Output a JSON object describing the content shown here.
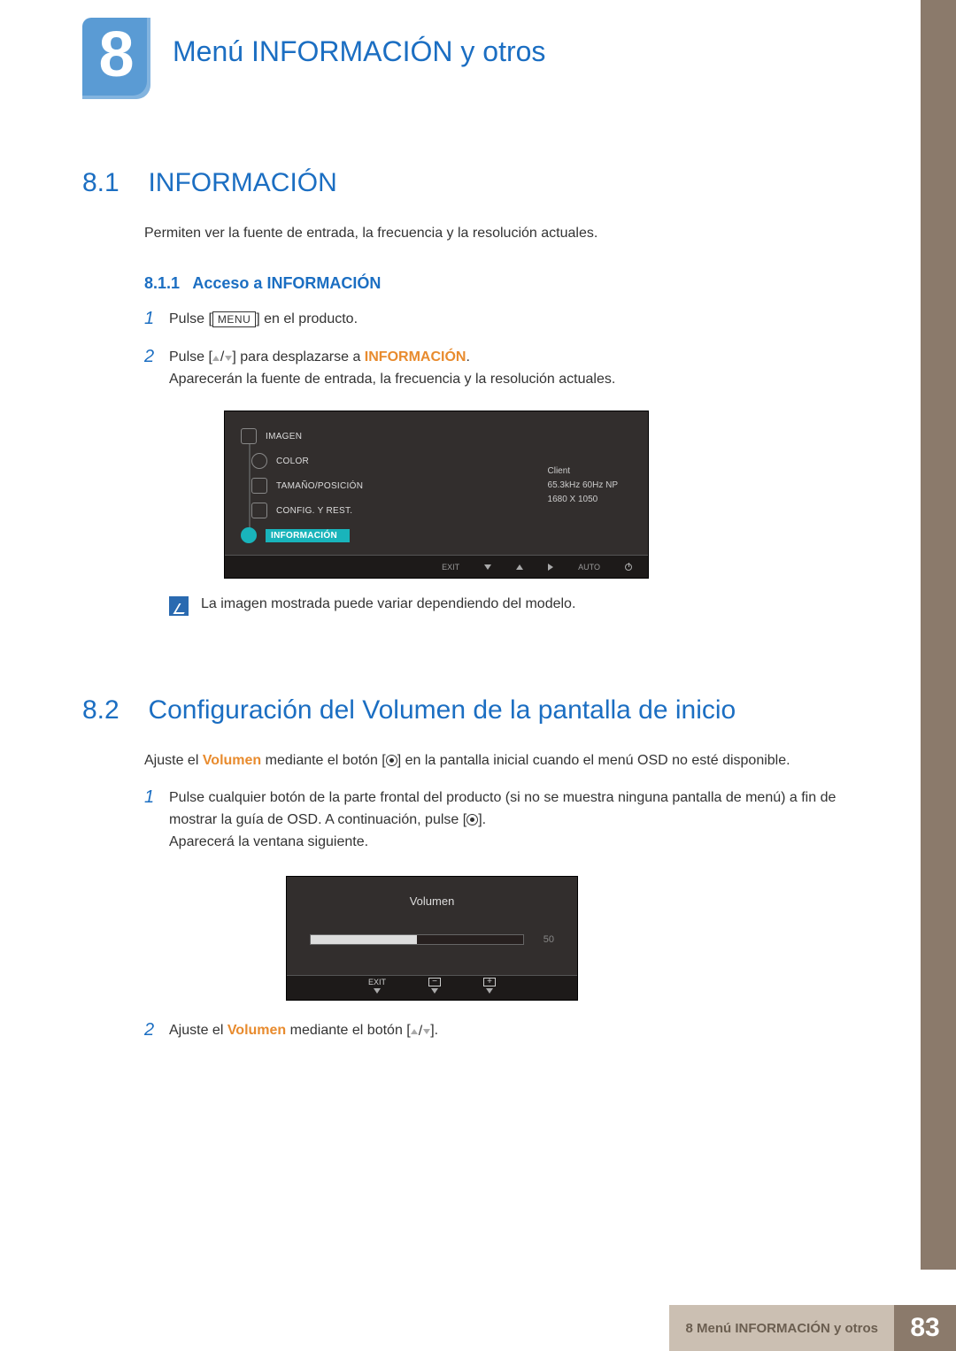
{
  "chapter": {
    "number": "8",
    "title": "Menú INFORMACIÓN y otros"
  },
  "section1": {
    "num": "8.1",
    "title": "INFORMACIÓN",
    "intro": "Permiten ver la fuente de entrada, la frecuencia y la resolución actuales.",
    "sub": {
      "num": "8.1.1",
      "title": "Acceso a INFORMACIÓN"
    },
    "steps": {
      "s1a": "Pulse [",
      "s1key": "MENU",
      "s1b": "] en el producto.",
      "s2a": "Pulse [",
      "s2b": "] para desplazarse a ",
      "s2orange": "INFORMACIÓN",
      "s2c": ".",
      "s2d": "Aparecerán la fuente de entrada, la frecuencia y la resolución actuales."
    },
    "osd": {
      "items": [
        "IMAGEN",
        "COLOR",
        "TAMAÑO/POSICIÓN",
        "CONFIG. Y REST.",
        "INFORMACIÓN"
      ],
      "info": {
        "l1": "Client",
        "l2": "65.3kHz 60Hz NP",
        "l3": "1680 X 1050"
      },
      "footer": {
        "exit": "EXIT",
        "auto": "AUTO"
      }
    },
    "note": "La imagen mostrada puede variar dependiendo del modelo."
  },
  "section2": {
    "num": "8.2",
    "title": "Configuración del Volumen de la pantalla de inicio",
    "intro_a": "Ajuste el ",
    "intro_orange": "Volumen",
    "intro_b": " mediante el botón [",
    "intro_c": "] en la pantalla inicial cuando el menú OSD no esté disponible.",
    "steps": {
      "s1a": "Pulse cualquier botón de la parte frontal del producto (si no se muestra ninguna pantalla de menú) a fin de mostrar la guía de OSD. A continuación, pulse [",
      "s1b": "].",
      "s1c": "Aparecerá la ventana siguiente.",
      "s2a": "Ajuste el ",
      "s2orange": "Volumen",
      "s2b": " mediante el botón [",
      "s2c": "]."
    },
    "vol": {
      "title": "Volumen",
      "value": "50",
      "exit": "EXIT"
    }
  },
  "footer": {
    "text": "8 Menú INFORMACIÓN y otros",
    "page": "83"
  }
}
